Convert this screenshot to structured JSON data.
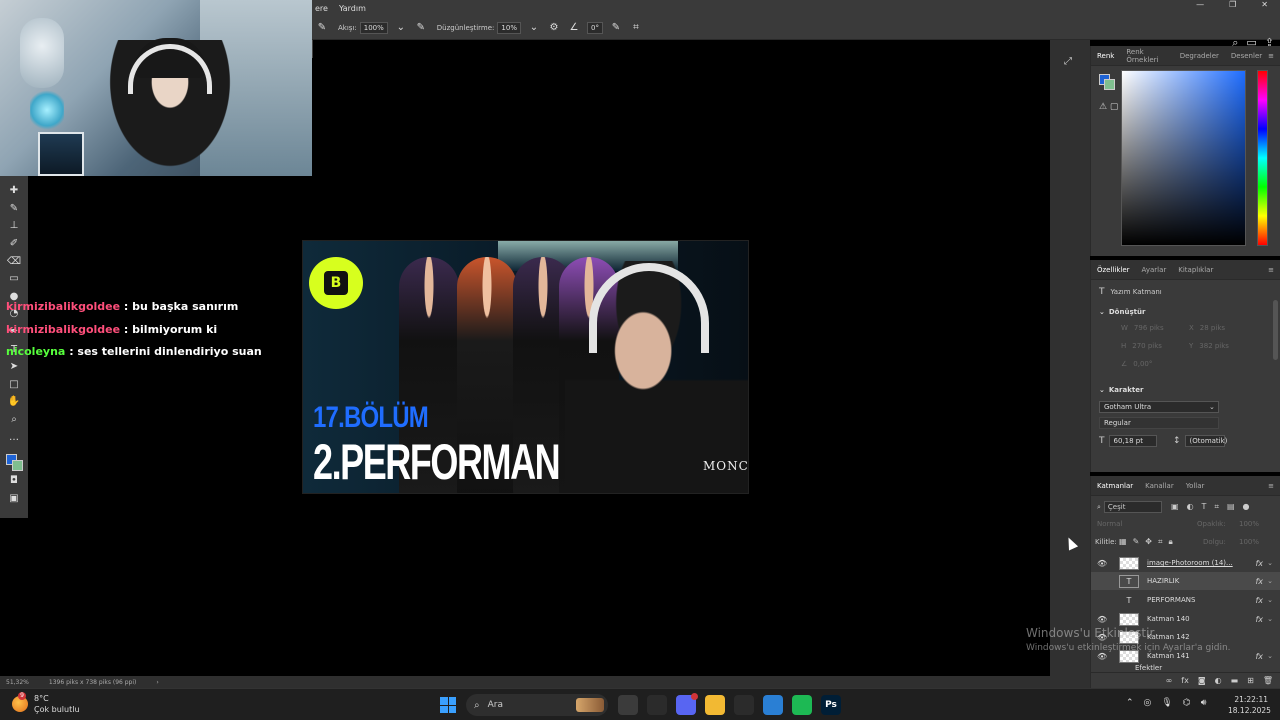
{
  "menubar": {
    "items": [
      "ere",
      "Yardım"
    ],
    "window_controls": [
      "—",
      "❐",
      "✕"
    ]
  },
  "options_bar": {
    "flow_label": "Akışı:",
    "flow_value": "100%",
    "smoothing_label": "Düzgünleştirme:",
    "smoothing_value": "10%",
    "angle_value": "0°"
  },
  "chat": {
    "messages": [
      {
        "user": "kirmizibalikgoldee",
        "text": ": bu başka sanırım",
        "color": "#ff4f7b"
      },
      {
        "user": "kirmizibalikgoldee",
        "text": ": bilmiyorum ki",
        "color": "#ff4f7b"
      },
      {
        "user": "nicoleyna",
        "text": ": ses tellerini dinlendiriyo suan",
        "color": "#57ff3d"
      }
    ]
  },
  "thumbnail": {
    "episode": "17.BÖLÜM",
    "title": "2.PERFORMAN",
    "badge_letter": "B",
    "shirt_text": "MONCLE"
  },
  "color_panel": {
    "tabs": [
      "Renk",
      "Renk Örnekleri",
      "Degradeler",
      "Desenler"
    ],
    "foreground": "#1e63d6",
    "background": "#7fbf8f"
  },
  "properties_panel": {
    "tabs": [
      "Özellikler",
      "Ayarlar",
      "Kitaplıklar"
    ],
    "layer_type": "Yazım Katmanı",
    "transform_label": "Dönüştür",
    "w": "796 piks",
    "x": "28 piks",
    "h": "270 piks",
    "y": "382 piks",
    "angle": "0,00°",
    "character_label": "Karakter",
    "font_family": "Gotham Ultra",
    "font_style": "Regular",
    "font_size": "60,18 pt",
    "leading": "(Otomatik)"
  },
  "layers_panel": {
    "tabs": [
      "Katmanlar",
      "Kanallar",
      "Yollar"
    ],
    "filter": "Çeşit",
    "blend_mode": "Normal",
    "opacity_label": "Opaklık:",
    "opacity_value": "100%",
    "lock_label": "Kilitle:",
    "fill_label": "Dolgu:",
    "fill_value": "100%",
    "layers": [
      {
        "name": "image-Photoroom (14)...",
        "kind": "image",
        "visible": true,
        "fx": true
      },
      {
        "name": "HAZIRLIK",
        "kind": "text",
        "visible": false,
        "fx": true,
        "selected": true
      },
      {
        "name": "PERFORMANS",
        "kind": "text",
        "visible": false,
        "fx": true
      },
      {
        "name": "Katman 140",
        "kind": "image",
        "visible": true,
        "fx": true
      },
      {
        "name": "Katman 142",
        "kind": "image",
        "visible": true,
        "fx": false
      },
      {
        "name": "Katman 141",
        "kind": "image",
        "visible": true,
        "fx": true
      }
    ],
    "partial_row": "Efektler"
  },
  "watermark": {
    "line1": "Windows'u Etkinleştir",
    "line2": "Windows'u etkinleştirmek için Ayarlar'a gidin."
  },
  "statusbar": {
    "zoom": "51,32%",
    "doc_info": "1396 piks x 738 piks (96 ppi)"
  },
  "taskbar": {
    "temperature": "8°C",
    "weather": "Çok bulutlu",
    "weather_badge": "9",
    "search_placeholder": "Ara",
    "time": "21:22:11",
    "date": "18.12.2025",
    "apps": [
      {
        "name": "file-explorer-app",
        "label": "",
        "color": "#3b3b3b"
      },
      {
        "name": "chrome-app",
        "label": "",
        "color": "#2b2b2b"
      },
      {
        "name": "discord-app",
        "label": "",
        "color": "#5865f2"
      },
      {
        "name": "folder-app",
        "label": "",
        "color": "#f2b933"
      },
      {
        "name": "github-app",
        "label": "",
        "color": "#2b2b2b"
      },
      {
        "name": "photos-app",
        "label": "",
        "color": "#2a7fd4"
      },
      {
        "name": "spotify-app",
        "label": "",
        "color": "#1db954"
      },
      {
        "name": "photoshop-app",
        "label": "Ps",
        "color": "#001e36"
      }
    ]
  }
}
